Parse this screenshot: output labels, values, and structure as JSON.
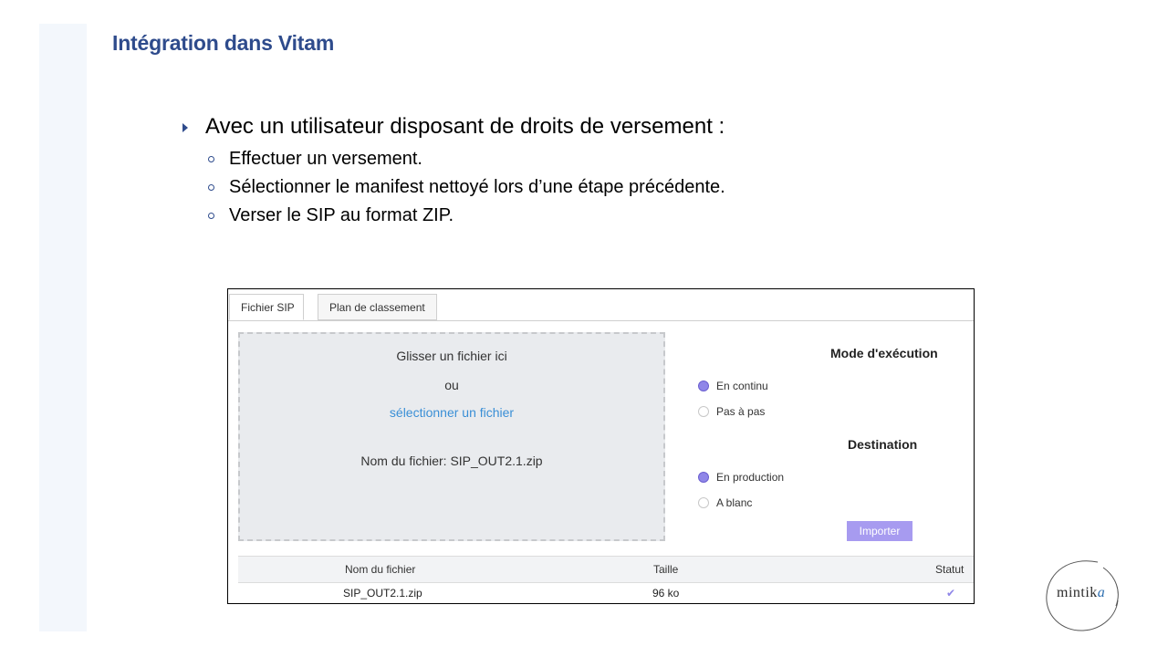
{
  "slide": {
    "title": "Intégration dans Vitam",
    "bullet_main": "Avec un utilisateur disposant de droits de versement :",
    "sub_bullets": [
      "Effectuer un versement.",
      "Sélectionner le manifest nettoyé lors d’une étape précédente.",
      "Verser le SIP au format ZIP."
    ]
  },
  "app": {
    "tabs": [
      {
        "label": "Fichier SIP",
        "active": true
      },
      {
        "label": "Plan de classement",
        "active": false
      }
    ],
    "dropzone": {
      "drag_text": "Glisser un fichier ici",
      "or_text": "ou",
      "select_link": "sélectionner un fichier",
      "filename_text": "Nom du fichier: SIP_OUT2.1.zip"
    },
    "execution_mode": {
      "title": "Mode d'exécution",
      "options": [
        {
          "label": "En continu",
          "selected": true
        },
        {
          "label": "Pas à pas",
          "selected": false
        }
      ]
    },
    "destination": {
      "title": "Destination",
      "options": [
        {
          "label": "En production",
          "selected": true
        },
        {
          "label": "A blanc",
          "selected": false
        }
      ]
    },
    "import_button": "Importer",
    "table": {
      "columns": [
        "Nom du fichier",
        "Taille",
        "Statut"
      ],
      "rows": [
        {
          "name": "SIP_OUT2.1.zip",
          "size": "96 ko",
          "status_icon": "check-icon"
        }
      ]
    }
  },
  "logo": {
    "text_main": "mintik",
    "text_accent": "a"
  },
  "colors": {
    "title": "#2e4b8c",
    "accent_purple": "#8f86e8",
    "link_blue": "#3a8fd6"
  }
}
